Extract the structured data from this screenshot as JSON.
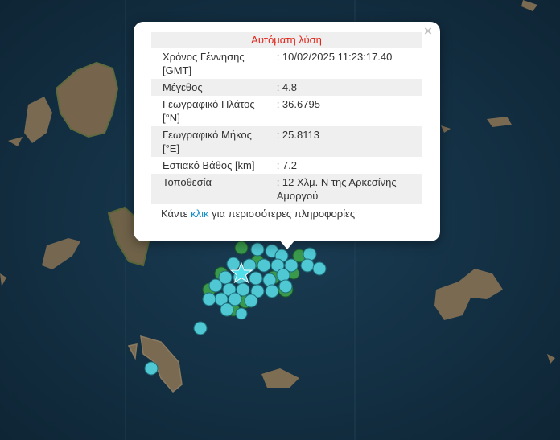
{
  "map": {
    "water_color": "#14334a",
    "land_color": "#7a6a52",
    "vegetation_color": "#4f5a3c",
    "epicenter_icon": "star-icon",
    "epicenter_color": "#4fe0ec",
    "recent_event_color": "#4fc8d4",
    "older_event_color": "#3a9a4c"
  },
  "popup": {
    "title": "Αυτόματη λύση",
    "close_symbol": "×",
    "rows": [
      {
        "label_line1": "Χρόνος Γέννησης",
        "label_line2": "[GMT]",
        "value": ": 10/02/2025 11:23:17.40"
      },
      {
        "label_line1": "Μέγεθος",
        "label_line2": "",
        "value": ": 4.8"
      },
      {
        "label_line1": "Γεωγραφικό Πλάτος",
        "label_line2": "[°N]",
        "value": ": 36.6795"
      },
      {
        "label_line1": "Γεωγραφικό Μήκος",
        "label_line2": "[°E]",
        "value": ": 25.8113"
      },
      {
        "label_line1": "Εστιακό Βάθος [km]",
        "label_line2": "",
        "value": ": 7.2"
      },
      {
        "label_line1": "Τοποθεσία",
        "label_line2": "",
        "value": ": 12 Χλμ. Ν της Αρκεσίνης",
        "value_line2": "Αμοργού"
      }
    ],
    "footer_prefix": "Κάντε",
    "footer_link": "κλικ",
    "footer_suffix": "για περισσότερες πληροφορίες"
  }
}
